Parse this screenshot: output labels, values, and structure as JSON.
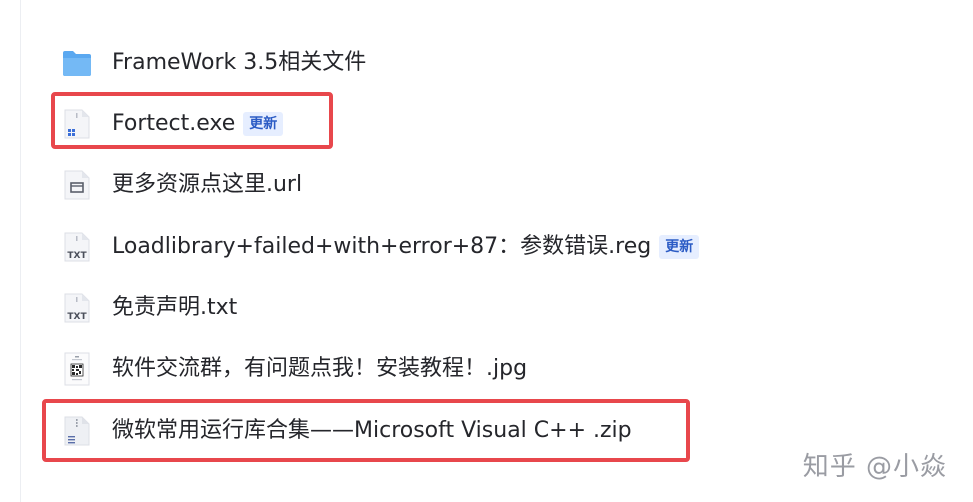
{
  "files": [
    {
      "name": "FrameWork 3.5相关文件",
      "icon": "folder-icon",
      "badge": ""
    },
    {
      "name": "Fortect.exe",
      "icon": "exe-file-icon",
      "badge": "更新"
    },
    {
      "name": "更多资源点这里.url",
      "icon": "url-file-icon",
      "badge": ""
    },
    {
      "name": "Loadlibrary+failed+with+error+87：参数错误.reg",
      "icon": "txt-file-icon",
      "badge": "更新"
    },
    {
      "name": "免责声明.txt",
      "icon": "txt-file-icon",
      "badge": ""
    },
    {
      "name": "软件交流群，有问题点我！安装教程！.jpg",
      "icon": "image-thumbnail-icon",
      "badge": ""
    },
    {
      "name": "微软常用运行库合集——Microsoft Visual C++ .zip",
      "icon": "zip-file-icon",
      "badge": ""
    }
  ],
  "file_icon_label": {
    "txt": "TXT"
  },
  "colors": {
    "highlight": "#e8474c",
    "badge_text": "#2c5cc5",
    "badge_bg": "#e6eeff",
    "folder": "#5aa8f0"
  },
  "watermark": "知乎 @小焱"
}
